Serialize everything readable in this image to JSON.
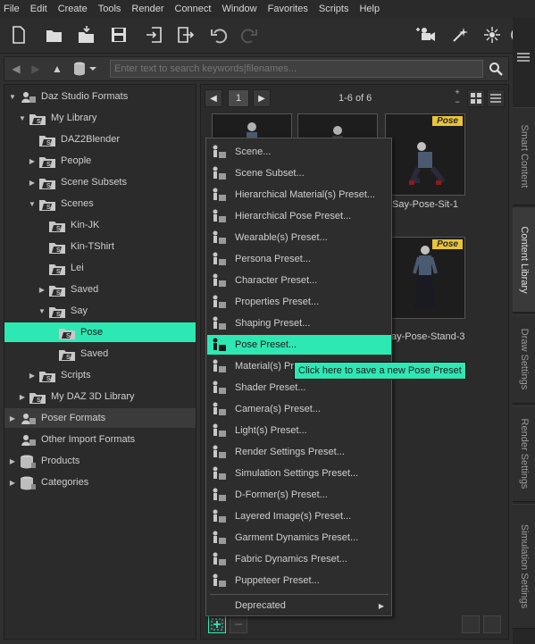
{
  "menu": [
    "File",
    "Edit",
    "Create",
    "Tools",
    "Render",
    "Connect",
    "Window",
    "Favorites",
    "Scripts",
    "Help"
  ],
  "search": {
    "placeholder": "Enter text to search keywords|filenames..."
  },
  "tree": [
    {
      "label": "Daz Studio Formats",
      "indent": 0,
      "arrow": "down",
      "icon": "daz"
    },
    {
      "label": "My Library",
      "indent": 1,
      "arrow": "down",
      "icon": "folder-s"
    },
    {
      "label": "DAZ2Blender",
      "indent": 2,
      "arrow": "",
      "icon": "folder-s"
    },
    {
      "label": "People",
      "indent": 2,
      "arrow": "right",
      "icon": "folder-s"
    },
    {
      "label": "Scene Subsets",
      "indent": 2,
      "arrow": "right",
      "icon": "folder-s"
    },
    {
      "label": "Scenes",
      "indent": 2,
      "arrow": "down",
      "icon": "folder-s"
    },
    {
      "label": "Kin-JK",
      "indent": 3,
      "arrow": "",
      "icon": "folder-s"
    },
    {
      "label": "Kin-TShirt",
      "indent": 3,
      "arrow": "",
      "icon": "folder-s"
    },
    {
      "label": "Lei",
      "indent": 3,
      "arrow": "",
      "icon": "folder-s"
    },
    {
      "label": "Saved",
      "indent": 3,
      "arrow": "right",
      "icon": "folder-s"
    },
    {
      "label": "Say",
      "indent": 3,
      "arrow": "down",
      "icon": "folder-s"
    },
    {
      "label": "Pose",
      "indent": 4,
      "arrow": "",
      "icon": "folder-s",
      "selected": true
    },
    {
      "label": "Saved",
      "indent": 4,
      "arrow": "",
      "icon": "folder-s"
    },
    {
      "label": "Scripts",
      "indent": 2,
      "arrow": "right",
      "icon": "folder-s"
    },
    {
      "label": "My DAZ 3D Library",
      "indent": 1,
      "arrow": "right",
      "icon": "folder-s"
    },
    {
      "label": "Poser Formats",
      "indent": 0,
      "arrow": "right",
      "icon": "poser",
      "hover": true
    },
    {
      "label": "Other Import Formats",
      "indent": 0,
      "arrow": "",
      "icon": "poser"
    },
    {
      "label": "Products",
      "indent": 0,
      "arrow": "right",
      "icon": "db"
    },
    {
      "label": "Categories",
      "indent": 0,
      "arrow": "right",
      "icon": "db"
    }
  ],
  "pager": {
    "page": "1",
    "count": "1-6 of 6"
  },
  "thumbs": [
    {
      "label": "",
      "badge": ""
    },
    {
      "label": "",
      "badge": ""
    },
    {
      "label": "Say-Pose-Sit-1",
      "badge": "Pose"
    },
    {
      "label": "ay-Pose-Stand-3",
      "badge": "Pose"
    }
  ],
  "context_menu": [
    "Scene...",
    "Scene Subset...",
    "Hierarchical Material(s) Preset...",
    "Hierarchical Pose Preset...",
    "Wearable(s) Preset...",
    "Persona Preset...",
    "Character Preset...",
    "Properties Preset...",
    "Shaping Preset...",
    "Pose Preset...",
    "Material(s) Pre",
    "Shader Preset...",
    "Camera(s) Preset...",
    "Light(s) Preset...",
    "Render Settings Preset...",
    "Simulation Settings Preset...",
    "D-Former(s) Preset...",
    "Layered Image(s) Preset...",
    "Garment Dynamics Preset...",
    "Fabric Dynamics Preset...",
    "Puppeteer Preset...",
    "Deprecated"
  ],
  "context_selected_index": 9,
  "tooltip": "Click here to save a new Pose Preset",
  "right_tabs": [
    "Smart Content",
    "Content Library",
    "Draw Settings",
    "Render Settings",
    "Simulation Settings"
  ],
  "active_tab": "Content Library",
  "colors": {
    "highlight": "#2ee8b4",
    "badge": "#e8c43a",
    "panel": "#2b2b2b"
  }
}
